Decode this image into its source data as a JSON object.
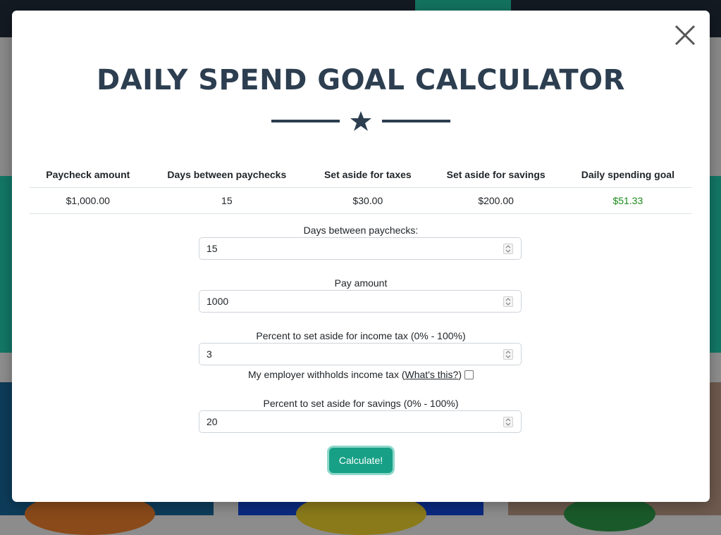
{
  "modal": {
    "title": "DAILY SPEND GOAL CALCULATOR",
    "close_icon": "close-icon",
    "divider_icon": "star-icon"
  },
  "summary": {
    "headers": [
      "Paycheck amount",
      "Days between paychecks",
      "Set aside for taxes",
      "Set aside for savings",
      "Daily spending goal"
    ],
    "values": [
      "$1,000.00",
      "15",
      "$30.00",
      "$200.00",
      "$51.33"
    ],
    "goal_color": "#1b8a1b"
  },
  "form": {
    "days_label": "Days between paychecks:",
    "days_value": "15",
    "pay_label": "Pay amount",
    "pay_value": "1000",
    "tax_label": "Percent to set aside for income tax (0% - 100%)",
    "tax_value": "3",
    "withhold_prefix": "My employer withholds income tax (",
    "withhold_link": "What's this?",
    "withhold_suffix": ")",
    "withhold_checked": false,
    "savings_label": "Percent to set aside for savings (0% - 100%)",
    "savings_value": "20",
    "calculate_label": "Calculate!"
  },
  "colors": {
    "title": "#2c3e50",
    "button": "#17a086"
  }
}
